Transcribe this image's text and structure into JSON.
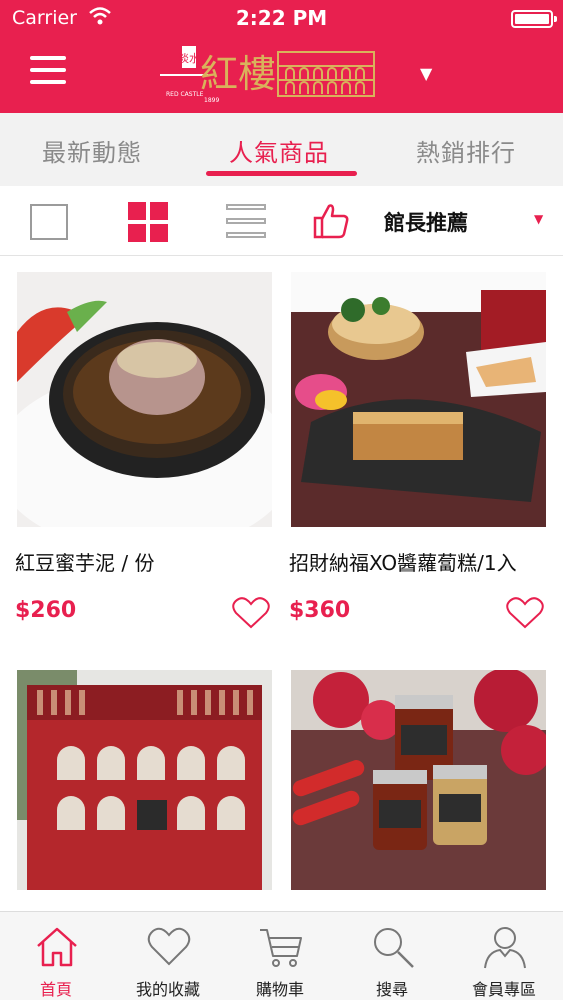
{
  "status_bar": {
    "carrier": "Carrier",
    "time": "2:22 PM"
  },
  "header": {
    "logo_text_main": "紅樓",
    "logo_text_small": "淡水",
    "logo_text_en": "RED CASTLE",
    "logo_text_year": "1899"
  },
  "tabs": [
    {
      "label": "最新動態",
      "active": false
    },
    {
      "label": "人氣商品",
      "active": true
    },
    {
      "label": "熱銷排行",
      "active": false
    }
  ],
  "toolbar": {
    "sort_label": "館長推薦"
  },
  "products": [
    {
      "name": "紅豆蜜芋泥 / 份",
      "price": "$260"
    },
    {
      "name": "招財納福XO醬蘿蔔糕/1入",
      "price": "$360"
    },
    {
      "name": "",
      "price": ""
    },
    {
      "name": "",
      "price": ""
    }
  ],
  "bottom_nav": [
    {
      "label": "首頁",
      "icon": "home-icon",
      "active": true
    },
    {
      "label": "我的收藏",
      "icon": "heart-icon",
      "active": false
    },
    {
      "label": "購物車",
      "icon": "cart-icon",
      "active": false
    },
    {
      "label": "搜尋",
      "icon": "search-icon",
      "active": false
    },
    {
      "label": "會員專區",
      "icon": "user-icon",
      "active": false
    }
  ],
  "colors": {
    "accent": "#e8204f",
    "tab_bg": "#f2f2f2",
    "gold": "#d9b25b"
  }
}
